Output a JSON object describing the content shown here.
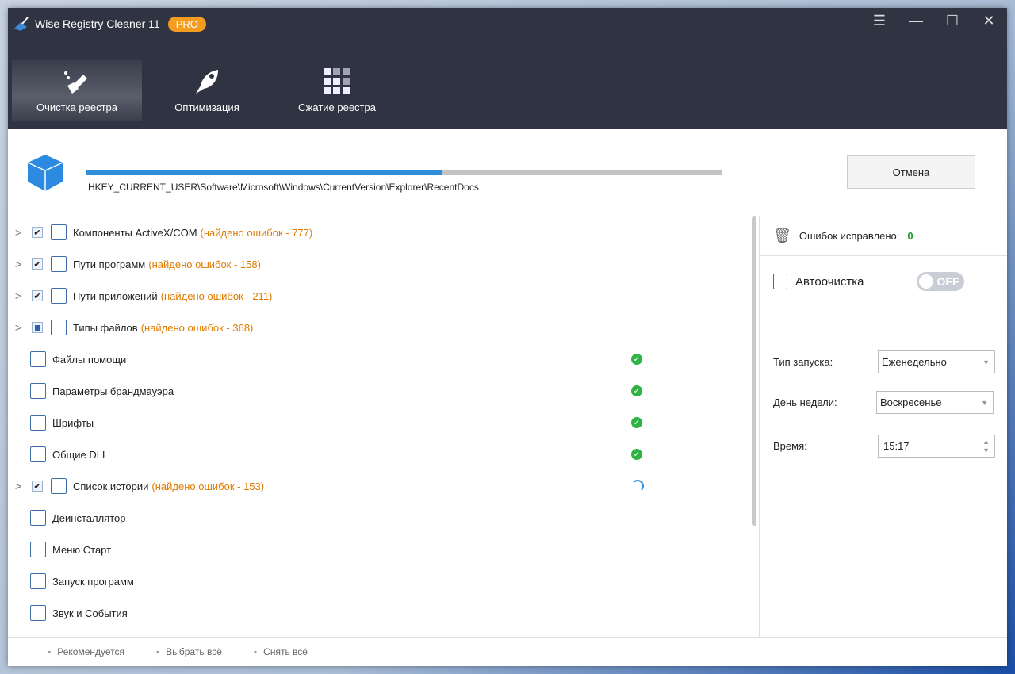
{
  "app": {
    "title": "Wise Registry Cleaner 11",
    "badge": "PRO"
  },
  "tabs": [
    {
      "label": "Очистка реестра"
    },
    {
      "label": "Оптимизация"
    },
    {
      "label": "Сжатие реестра"
    }
  ],
  "scan": {
    "progress_percent": 56,
    "path": "HKEY_CURRENT_USER\\Software\\Microsoft\\Windows\\CurrentVersion\\Explorer\\RecentDocs",
    "cancel": "Отмена"
  },
  "items": [
    {
      "label": "Компоненты ActiveX/COM",
      "errors": "(найдено ошибок - 777)",
      "state": "checked"
    },
    {
      "label": "Пути программ",
      "errors": "(найдено ошибок - 158)",
      "state": "checked"
    },
    {
      "label": "Пути приложений",
      "errors": "(найдено ошибок - 211)",
      "state": "checked"
    },
    {
      "label": "Типы файлов",
      "errors": "(найдено ошибок - 368)",
      "state": "partial"
    },
    {
      "label": "Файлы помощи",
      "status": "ok"
    },
    {
      "label": "Параметры брандмауэра",
      "status": "ok"
    },
    {
      "label": "Шрифты",
      "status": "ok"
    },
    {
      "label": "Общие DLL",
      "status": "ok"
    },
    {
      "label": "Список истории",
      "errors": "(найдено ошибок - 153)",
      "state": "checked",
      "status": "scanning"
    },
    {
      "label": "Деинсталлятор"
    },
    {
      "label": "Меню Старт"
    },
    {
      "label": "Запуск программ"
    },
    {
      "label": "Звук и События"
    }
  ],
  "side": {
    "fixed_label": "Ошибок исправлено:",
    "fixed_count": "0",
    "auto_label": "Автоочистка",
    "toggle": "OFF",
    "run_type_label": "Тип запуска:",
    "run_type": "Еженедельно",
    "day_label": "День недели:",
    "day": "Воскресенье",
    "time_label": "Время:",
    "time": "15:17"
  },
  "footer": {
    "recommended": "Рекомендуется",
    "select_all": "Выбрать всё",
    "deselect_all": "Снять всё"
  }
}
